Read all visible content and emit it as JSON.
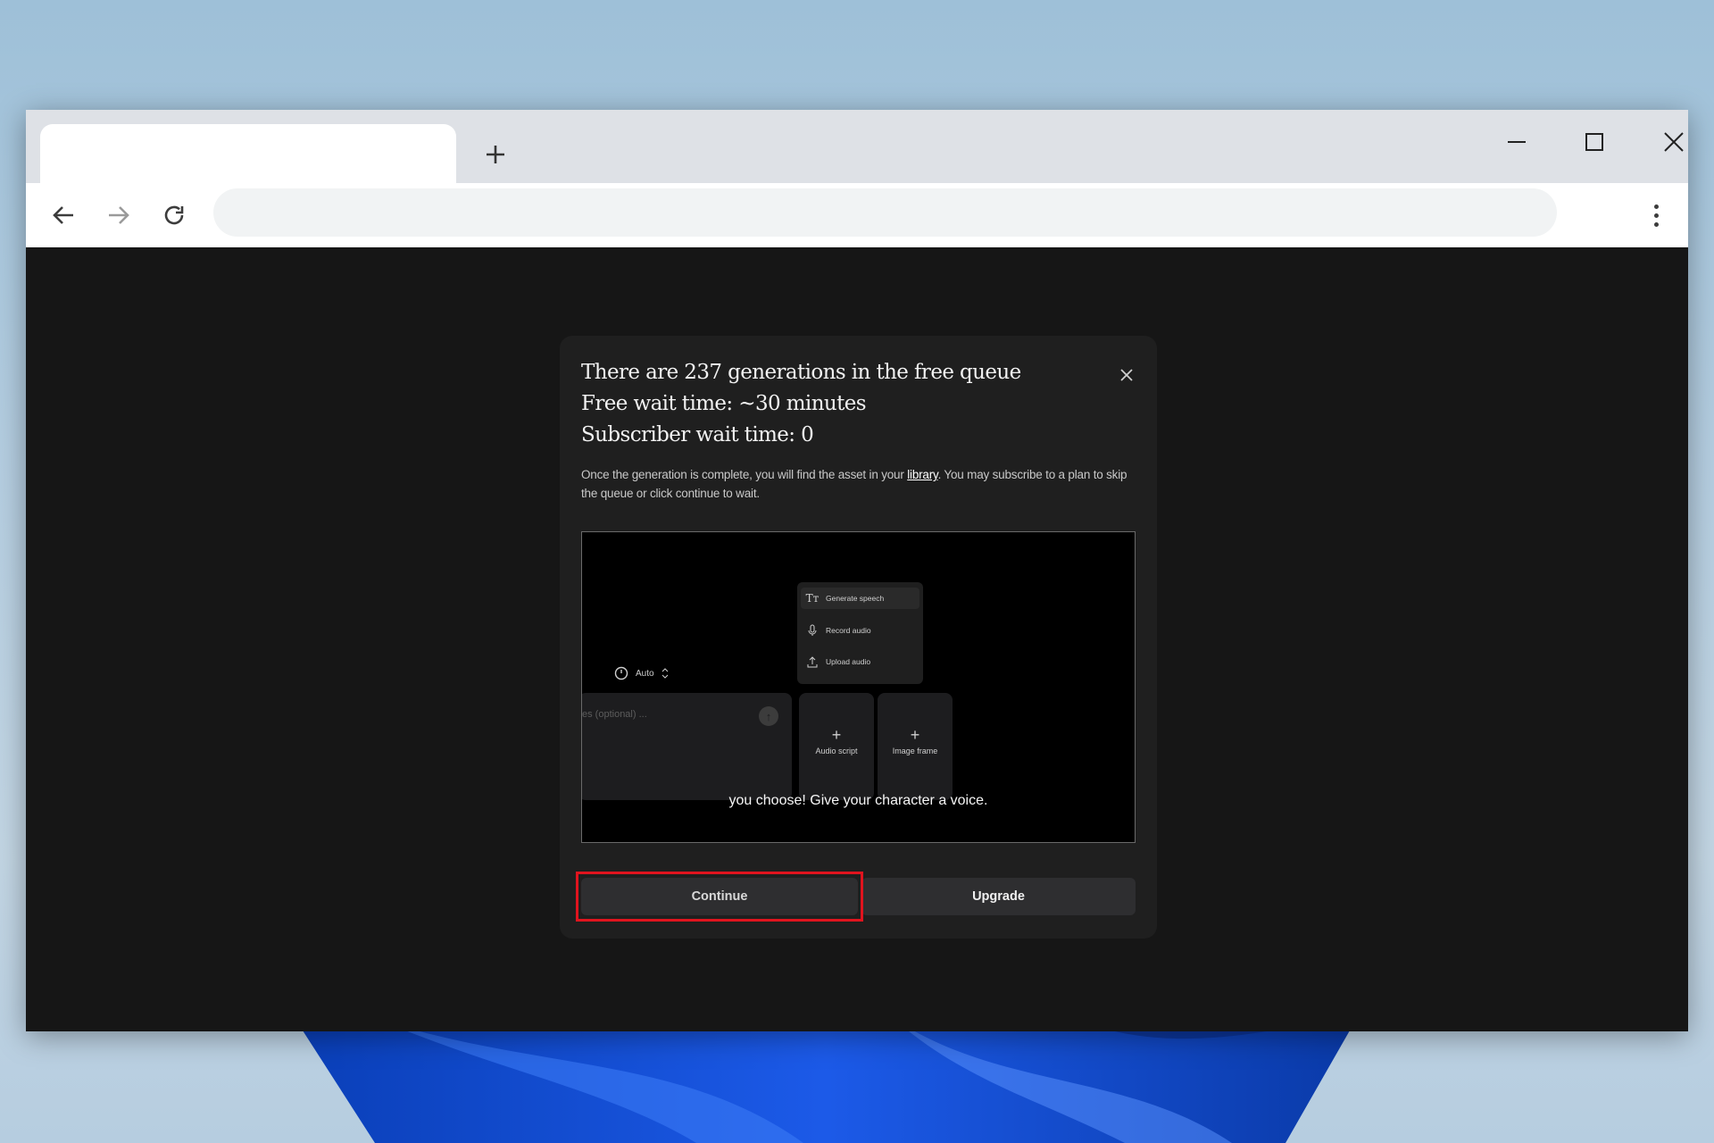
{
  "browser": {
    "tab_title": "",
    "new_tab_icon": "plus-icon",
    "url": "",
    "controls": {
      "minimize_icon": "minimize-icon",
      "maximize_icon": "maximize-icon",
      "close_icon": "close-icon"
    },
    "nav": {
      "back_icon": "arrow-left-icon",
      "forward_icon": "arrow-right-icon",
      "reload_icon": "reload-icon",
      "menu_icon": "kebab-menu-icon"
    }
  },
  "modal": {
    "title_lines": [
      "There are 237 generations in the free queue",
      "Free wait time: ~30 minutes",
      "Subscriber wait time: 0"
    ],
    "description_before": "Once the generation is complete, you will find the asset in your ",
    "description_link": "library",
    "description_after": ". You may subscribe to a plan to skip the queue or click continue to wait.",
    "close_icon": "close-icon",
    "preview": {
      "menu_items": [
        {
          "icon": "text-icon",
          "label": "Generate speech"
        },
        {
          "icon": "microphone-icon",
          "label": "Record audio"
        },
        {
          "icon": "upload-icon",
          "label": "Upload audio"
        }
      ],
      "auto_label": "Auto",
      "input_placeholder": "es (optional) ...",
      "cards": [
        {
          "label": "Audio script"
        },
        {
          "label": "Image frame"
        }
      ],
      "caption": "you choose! Give your character a voice."
    },
    "buttons": {
      "continue": "Continue",
      "upgrade": "Upgrade"
    },
    "highlight_color": "#e0141e"
  },
  "colors": {
    "page_background": "#161616",
    "modal_background": "#1f1f1f",
    "button_background": "#2e2e30"
  }
}
